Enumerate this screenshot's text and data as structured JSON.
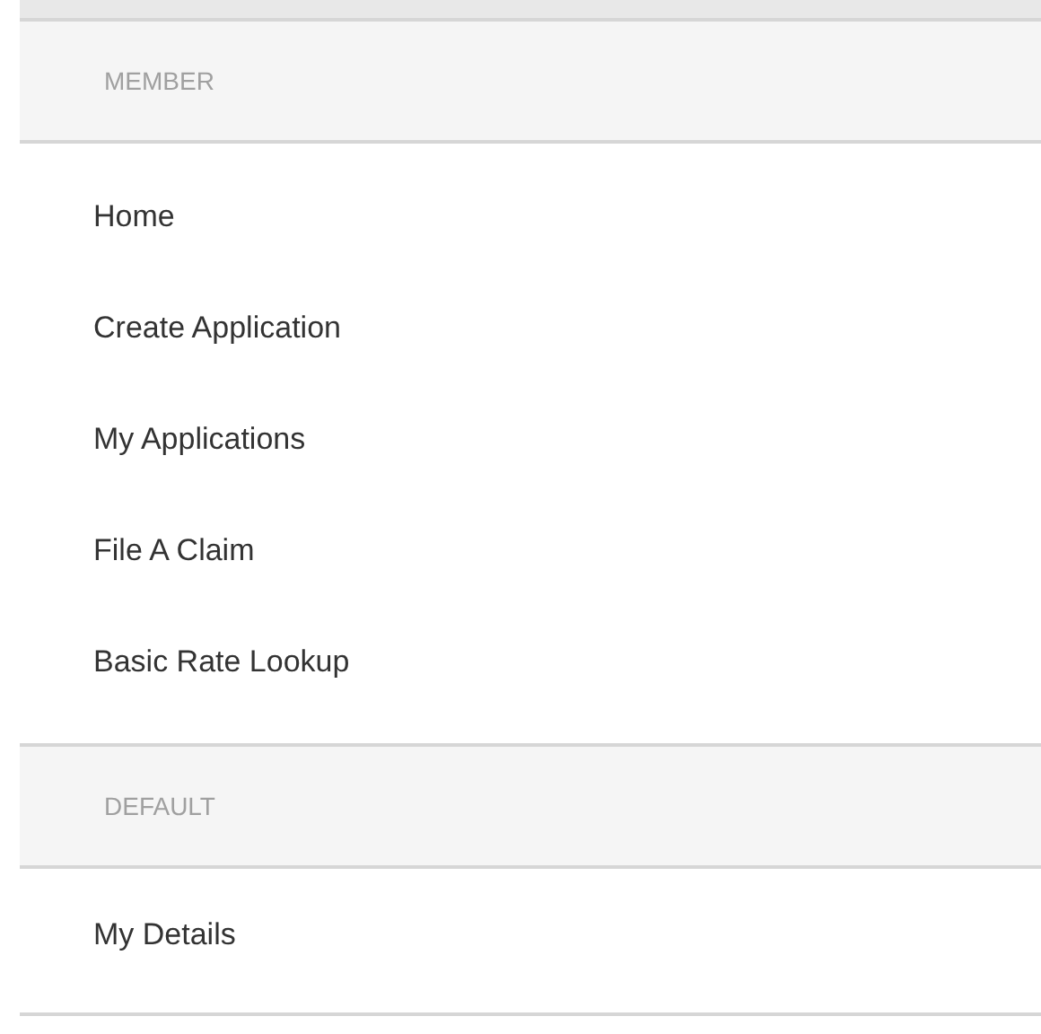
{
  "sections": [
    {
      "title": "MEMBER",
      "items": [
        {
          "label": "Home"
        },
        {
          "label": "Create Application"
        },
        {
          "label": "My Applications"
        },
        {
          "label": "File A Claim"
        },
        {
          "label": "Basic Rate Lookup"
        }
      ]
    },
    {
      "title": "DEFAULT",
      "items": [
        {
          "label": "My Details"
        }
      ]
    }
  ]
}
